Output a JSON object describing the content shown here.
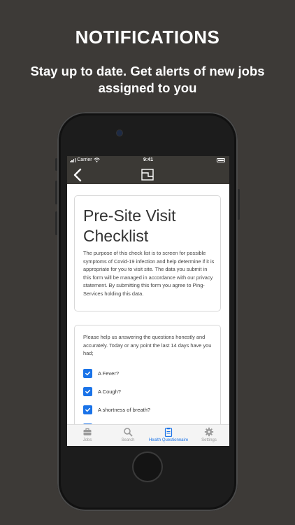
{
  "promo": {
    "headline": "NOTIFICATIONS",
    "subhead": "Stay up to date. Get alerts of new jobs assigned to you"
  },
  "status_bar": {
    "carrier": "Carrier",
    "time": "9:41"
  },
  "checklist": {
    "title": "Pre-Site Visit Checklist",
    "intro": "The purpose of this check list is to screen for possible symptoms of Covid-19 infection and help determine if it is appropriate for you to visit site. The data you submit in this form will be managed in accordance with our privacy statement. By submitting this form you agree to Ping-Services holding this data.",
    "question_prompt": "Please help us answering the questions honestly and accurately. Today or any point the last 14 days have you had;",
    "questions": [
      {
        "label": "A Fever?",
        "checked": true
      },
      {
        "label": "A Cough?",
        "checked": true
      },
      {
        "label": "A shortness of breath?",
        "checked": true
      }
    ]
  },
  "tabs": [
    {
      "label": "Jobs",
      "icon": "briefcase-icon",
      "active": false
    },
    {
      "label": "Search",
      "icon": "search-icon",
      "active": false
    },
    {
      "label": "Health Questionnaire",
      "icon": "clipboard-icon",
      "active": true
    },
    {
      "label": "Settings",
      "icon": "gear-icon",
      "active": false
    }
  ],
  "colors": {
    "background": "#3d3a37",
    "nav_bar": "#3b3935",
    "accent": "#1a73e8",
    "inactive_tab": "#9a9a9a"
  }
}
